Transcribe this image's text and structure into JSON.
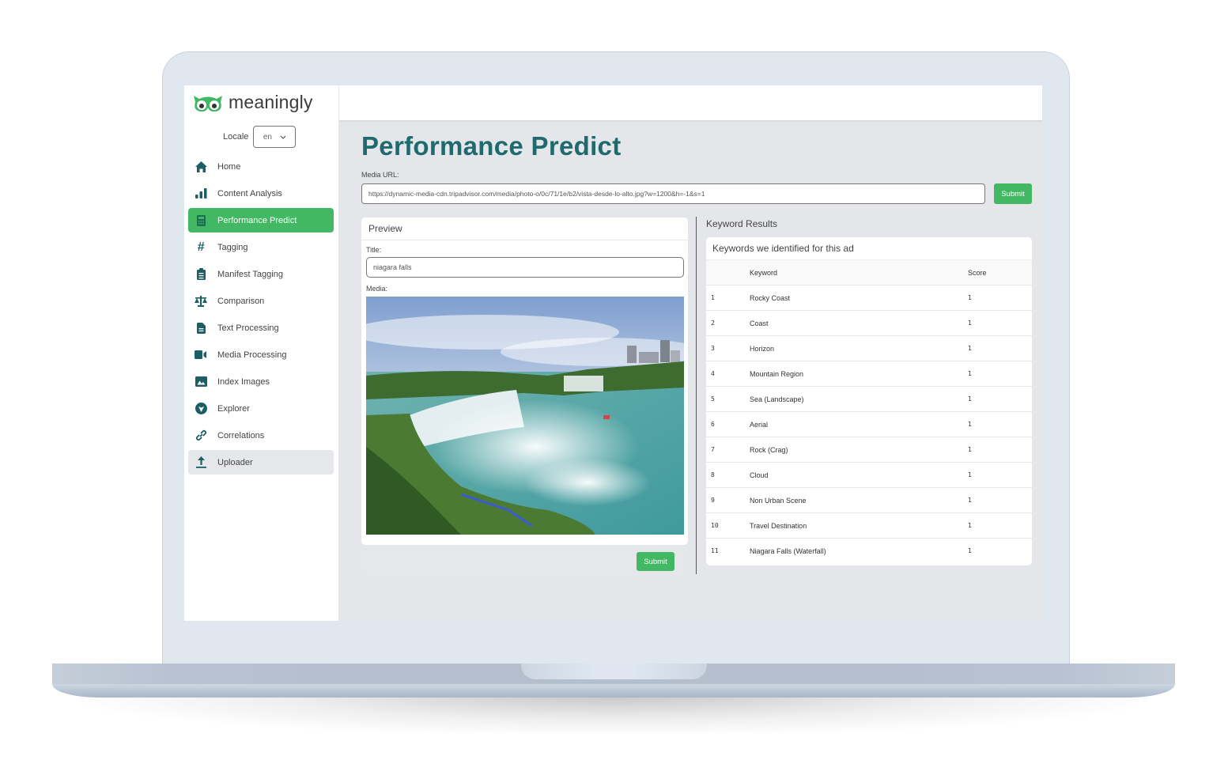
{
  "brand": {
    "name": "meaningly",
    "accent": "#43b864",
    "title_color": "#1e6a6e"
  },
  "locale": {
    "label": "Locale",
    "value": "en"
  },
  "sidebar": {
    "items": [
      {
        "label": "Home",
        "icon": "home-icon"
      },
      {
        "label": "Content Analysis",
        "icon": "bar-chart-icon"
      },
      {
        "label": "Performance Predict",
        "icon": "calculator-icon",
        "active": true
      },
      {
        "label": "Tagging",
        "icon": "hashtag-icon"
      },
      {
        "label": "Manifest Tagging",
        "icon": "clipboard-list-icon"
      },
      {
        "label": "Comparison",
        "icon": "balance-scale-icon"
      },
      {
        "label": "Text Processing",
        "icon": "file-text-icon"
      },
      {
        "label": "Media Processing",
        "icon": "video-icon"
      },
      {
        "label": "Index Images",
        "icon": "image-icon"
      },
      {
        "label": "Explorer",
        "icon": "explorer-icon"
      },
      {
        "label": "Correlations",
        "icon": "link-icon"
      },
      {
        "label": "Uploader",
        "icon": "upload-icon",
        "hover": true
      }
    ]
  },
  "main": {
    "title": "Performance Predict",
    "media_url_label": "Media URL:",
    "media_url_value": "https://dynamic-media-cdn.tripadvisor.com/media/photo-o/0c/71/1e/b2/vista-desde-lo-alto.jpg?w=1200&h=-1&s=1",
    "submit_label": "Submit"
  },
  "preview": {
    "heading": "Preview",
    "title_label": "Title:",
    "title_value": "niagara falls",
    "media_label": "Media:",
    "media_alt": "Niagara Falls aerial view",
    "submit_label": "Submit"
  },
  "keywords": {
    "section_title": "Keyword Results",
    "card_title": "Keywords we identified for this ad",
    "columns": [
      "",
      "Keyword",
      "Score"
    ],
    "rows": [
      {
        "index": "1",
        "keyword": "Rocky Coast",
        "score": "1"
      },
      {
        "index": "2",
        "keyword": "Coast",
        "score": "1"
      },
      {
        "index": "3",
        "keyword": "Horizon",
        "score": "1"
      },
      {
        "index": "4",
        "keyword": "Mountain Region",
        "score": "1"
      },
      {
        "index": "5",
        "keyword": "Sea (Landscape)",
        "score": "1"
      },
      {
        "index": "6",
        "keyword": "Aerial",
        "score": "1"
      },
      {
        "index": "7",
        "keyword": "Rock (Crag)",
        "score": "1"
      },
      {
        "index": "8",
        "keyword": "Cloud",
        "score": "1"
      },
      {
        "index": "9",
        "keyword": "Non Urban Scene",
        "score": "1"
      },
      {
        "index": "10",
        "keyword": "Travel Destination",
        "score": "1"
      },
      {
        "index": "11",
        "keyword": "Niagara Falls (Waterfall)",
        "score": "1"
      }
    ]
  }
}
